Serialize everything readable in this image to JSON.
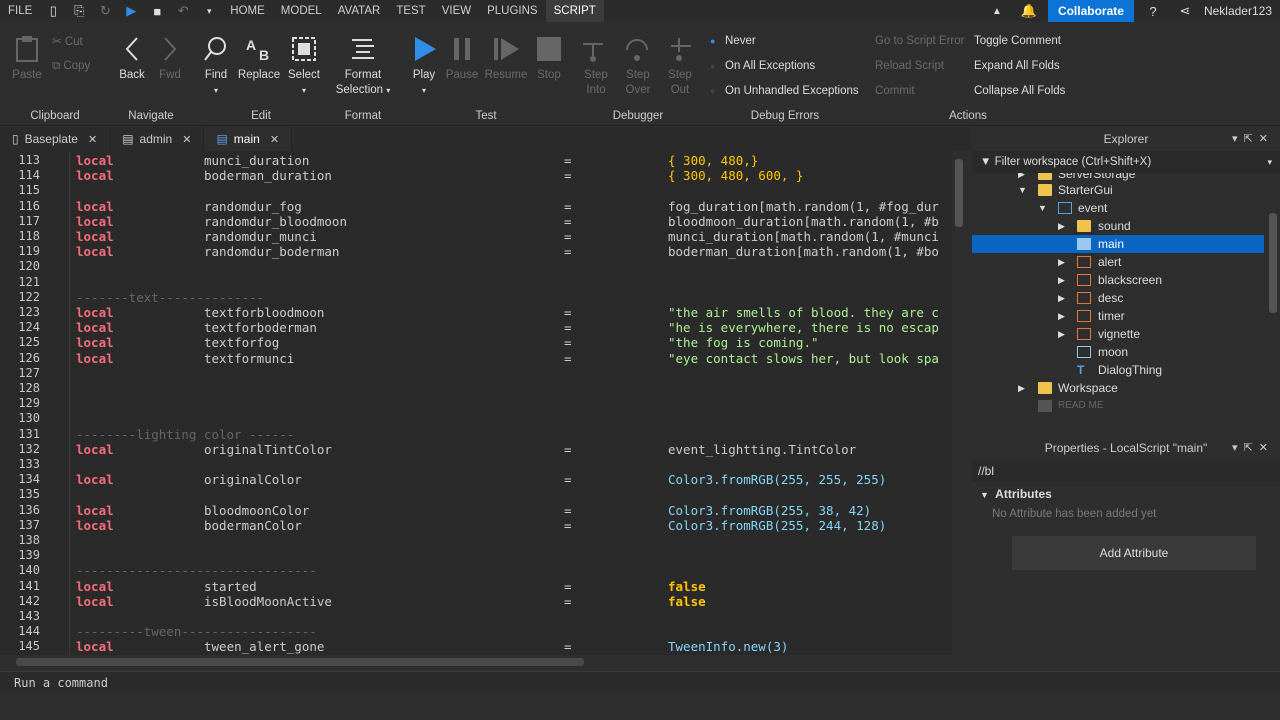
{
  "menubar": {
    "file": "FILE",
    "tabs": [
      "HOME",
      "MODEL",
      "AVATAR",
      "TEST",
      "VIEW",
      "PLUGINS",
      "SCRIPT"
    ],
    "collaborate": "Collaborate",
    "username": "Neklader123"
  },
  "ribbon": {
    "clipboard": {
      "label": "Clipboard",
      "paste": "Paste",
      "cut": "Cut",
      "copy": "Copy"
    },
    "navigate": {
      "label": "Navigate",
      "back": "Back",
      "fwd": "Fwd"
    },
    "edit": {
      "label": "Edit",
      "find": "Find",
      "replace": "Replace",
      "select": "Select"
    },
    "format": {
      "label": "Format",
      "format_selection": "Format",
      "format_selection2": "Selection"
    },
    "test": {
      "label": "Test",
      "play": "Play",
      "pause": "Pause",
      "resume": "Resume",
      "stop": "Stop"
    },
    "debugger": {
      "label": "Debugger",
      "step_into1": "Step",
      "step_into2": "Into",
      "step_over1": "Step",
      "step_over2": "Over",
      "step_out1": "Step",
      "step_out2": "Out"
    },
    "debug_errors": {
      "label": "Debug Errors",
      "never": "Never",
      "all": "On All Exceptions",
      "unhandled": "On Unhandled Exceptions"
    },
    "actions": {
      "label": "Actions",
      "goto": "Go to Script Error",
      "reload": "Reload Script",
      "commit": "Commit",
      "toggle": "Toggle Comment",
      "expand": "Expand All Folds",
      "collapse": "Collapse All Folds"
    }
  },
  "tabs": [
    {
      "label": "Baseplate"
    },
    {
      "label": "admin"
    },
    {
      "label": "main"
    }
  ],
  "editor": {
    "lines": [
      {
        "n": "113",
        "kw": "local",
        "id": "munci_duration",
        "eq": "=",
        "val": "{ 300, 480,}"
      },
      {
        "n": "114",
        "kw": "local",
        "id": "boderman_duration",
        "eq": "=",
        "val": "{ 300, 480, 600, }"
      },
      {
        "n": "115"
      },
      {
        "n": "116",
        "kw": "local",
        "id": "randomdur_fog",
        "eq": "=",
        "val": "fog_duration[math.random(1, #fog_dur"
      },
      {
        "n": "117",
        "kw": "local",
        "id": "randomdur_bloodmoon",
        "eq": "=",
        "val": "bloodmoon_duration[math.random(1, #b"
      },
      {
        "n": "118",
        "kw": "local",
        "id": "randomdur_munci",
        "eq": "=",
        "val": "munci_duration[math.random(1, #munci"
      },
      {
        "n": "119",
        "kw": "local",
        "id": "randomdur_boderman",
        "eq": "=",
        "val": "boderman_duration[math.random(1, #bo"
      },
      {
        "n": "120"
      },
      {
        "n": "121"
      },
      {
        "n": "122",
        "cmt": "-------text--------------"
      },
      {
        "n": "123",
        "kw": "local",
        "id": "textforbloodmoon",
        "eq": "=",
        "val": "\"the air smells of blood. they are c"
      },
      {
        "n": "124",
        "kw": "local",
        "id": "textforboderman",
        "eq": "=",
        "val": "\"he is everywhere, there is no escap"
      },
      {
        "n": "125",
        "kw": "local",
        "id": "textforfog",
        "eq": "=",
        "val": "\"the fog is coming.\""
      },
      {
        "n": "126",
        "kw": "local",
        "id": "textformunci",
        "eq": "=",
        "val": "\"eye contact slows her, but look spa"
      },
      {
        "n": "127"
      },
      {
        "n": "128"
      },
      {
        "n": "129"
      },
      {
        "n": "130"
      },
      {
        "n": "131",
        "cmt": "--------lighting color ------"
      },
      {
        "n": "132",
        "kw": "local",
        "id": "originalTintColor",
        "eq": "=",
        "val": "event_lightting.TintColor"
      },
      {
        "n": "133"
      },
      {
        "n": "134",
        "kw": "local",
        "id": "originalColor",
        "eq": "=",
        "val": "Color3.fromRGB(255, 255, 255)"
      },
      {
        "n": "135"
      },
      {
        "n": "136",
        "kw": "local",
        "id": "bloodmoonColor",
        "eq": "=",
        "val": "Color3.fromRGB(255, 38, 42)"
      },
      {
        "n": "137",
        "kw": "local",
        "id": "bodermanColor",
        "eq": "=",
        "val": "Color3.fromRGB(255, 244, 128)"
      },
      {
        "n": "138"
      },
      {
        "n": "139"
      },
      {
        "n": "140",
        "cmt": "--------------------------------"
      },
      {
        "n": "141",
        "kw": "local",
        "id": "started",
        "eq": "=",
        "val": "false"
      },
      {
        "n": "142",
        "kw": "local",
        "id": "isBloodMoonActive",
        "eq": "=",
        "val": "false"
      },
      {
        "n": "143"
      },
      {
        "n": "144",
        "cmt": "---------tween------------------"
      },
      {
        "n": "145",
        "kw": "local",
        "id": "tween_alert_gone",
        "eq": "=",
        "val": "TweenInfo.new(3)"
      }
    ]
  },
  "explorer": {
    "title": "Explorer",
    "filter": "Filter workspace (Ctrl+Shift+X)",
    "items": [
      {
        "label": "ServerStorage"
      },
      {
        "label": "StarterGui"
      },
      {
        "label": "event"
      },
      {
        "label": "sound"
      },
      {
        "label": "main"
      },
      {
        "label": "alert"
      },
      {
        "label": "blackscreen"
      },
      {
        "label": "desc"
      },
      {
        "label": "timer"
      },
      {
        "label": "vignette"
      },
      {
        "label": "moon"
      },
      {
        "label": "DialogThing"
      },
      {
        "label": "Workspace"
      },
      {
        "label": "READ ME"
      }
    ]
  },
  "properties": {
    "title": "Properties - LocalScript \"main\"",
    "filter": "//bl",
    "section": "Attributes",
    "empty": "No Attribute has been added yet",
    "add": "Add Attribute"
  },
  "command": {
    "placeholder": "Run a command"
  },
  "colors": {
    "accent": "#0b74d6",
    "keyword": "#f86d7c",
    "selection": "#0b66c2"
  }
}
